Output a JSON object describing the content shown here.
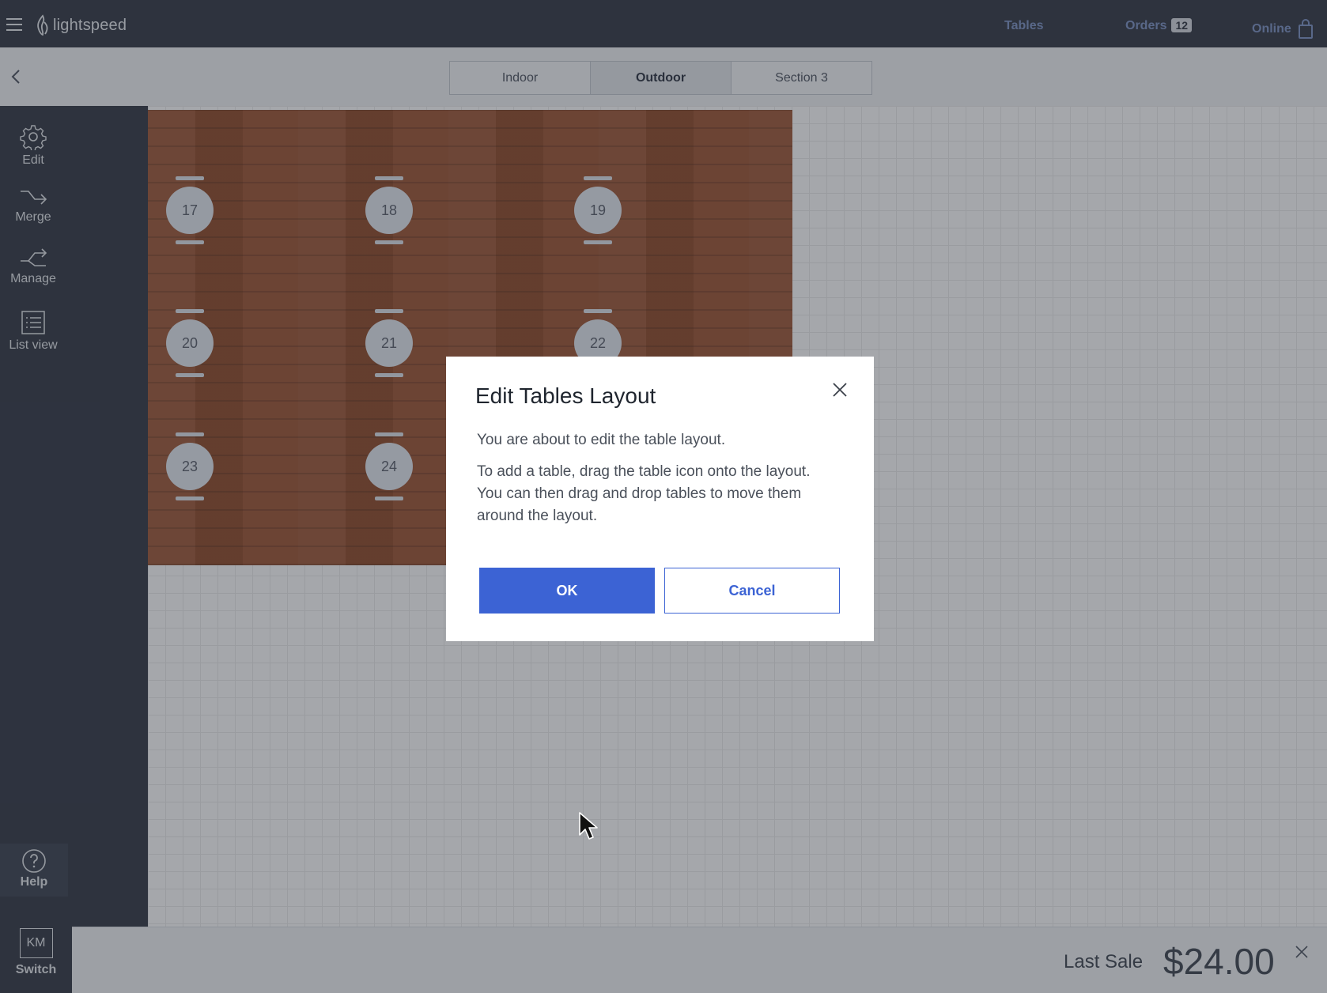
{
  "header": {
    "brand": "lightspeed",
    "nav_tables": "Tables",
    "nav_orders": "Orders",
    "orders_count": "12",
    "nav_online": "Online"
  },
  "sections": {
    "tabs": [
      {
        "label": "Indoor"
      },
      {
        "label": "Outdoor",
        "active": true
      },
      {
        "label": "Section 3"
      }
    ]
  },
  "sidebar": {
    "items": [
      {
        "label": "Edit",
        "icon": "gear-icon"
      },
      {
        "label": "Merge",
        "icon": "merge-arrow-icon"
      },
      {
        "label": "Manage",
        "icon": "split-arrow-icon"
      },
      {
        "label": "List view",
        "icon": "list-icon"
      }
    ],
    "help": "Help",
    "user_initials": "KM",
    "switch": "Switch"
  },
  "tables": [
    "17",
    "18",
    "19",
    "20",
    "21",
    "22",
    "23",
    "24"
  ],
  "bottom": {
    "last_sale_label": "Last Sale",
    "last_sale_amount": "$24.00"
  },
  "modal": {
    "title": "Edit Tables Layout",
    "p1": "You are about to edit the table layout.",
    "p2": "To add a table, drag the table icon onto the layout. You can then drag and drop tables to move them around the layout.",
    "ok": "OK",
    "cancel": "Cancel"
  },
  "colors": {
    "topbar": "#323844",
    "accent": "#3c63d4",
    "deck": "#9a4f2c"
  }
}
